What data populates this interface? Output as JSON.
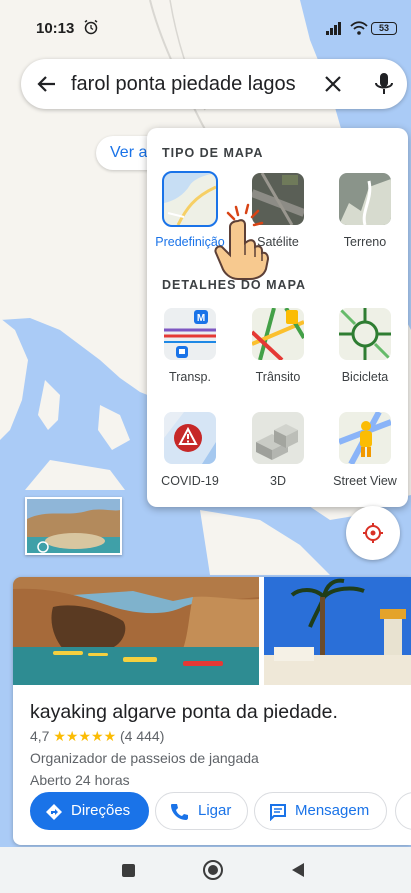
{
  "status_bar": {
    "time": "10:13",
    "battery": "53",
    "alarm_icon": "alarm-clock-icon",
    "signal_icon": "signal-icon",
    "wifi_icon": "wifi-icon"
  },
  "search": {
    "query": "farol ponta piedade lagos",
    "back_icon": "arrow-back-icon",
    "clear_icon": "close-icon",
    "mic_icon": "mic-icon"
  },
  "map_chip": {
    "label": "Ver a"
  },
  "layers_panel": {
    "map_type_title": "TIPO DE MAPA",
    "map_types": [
      {
        "label": "Predefinição",
        "selected": true
      },
      {
        "label": "Satélite",
        "selected": false
      },
      {
        "label": "Terreno",
        "selected": false
      }
    ],
    "details_title": "DETALHES DO MAPA",
    "details": [
      {
        "label": "Transp."
      },
      {
        "label": "Trânsito"
      },
      {
        "label": "Bicicleta"
      },
      {
        "label": "COVID-19"
      },
      {
        "label": "3D"
      },
      {
        "label": "Street View"
      }
    ]
  },
  "place_card": {
    "title": "kayaking algarve ponta da piedade.",
    "rating": "4,7",
    "stars": "★★★★★",
    "reviews": "(4 444)",
    "category": "Organizador de passeios de jangada",
    "hours": "Aberto 24 horas",
    "buttons": {
      "directions": "Direções",
      "call": "Ligar",
      "message": "Mensagem"
    }
  },
  "colors": {
    "accent": "#1a73e8",
    "star": "#fbbc04",
    "water": "#aacbf6",
    "land": "#f6f4ef"
  }
}
